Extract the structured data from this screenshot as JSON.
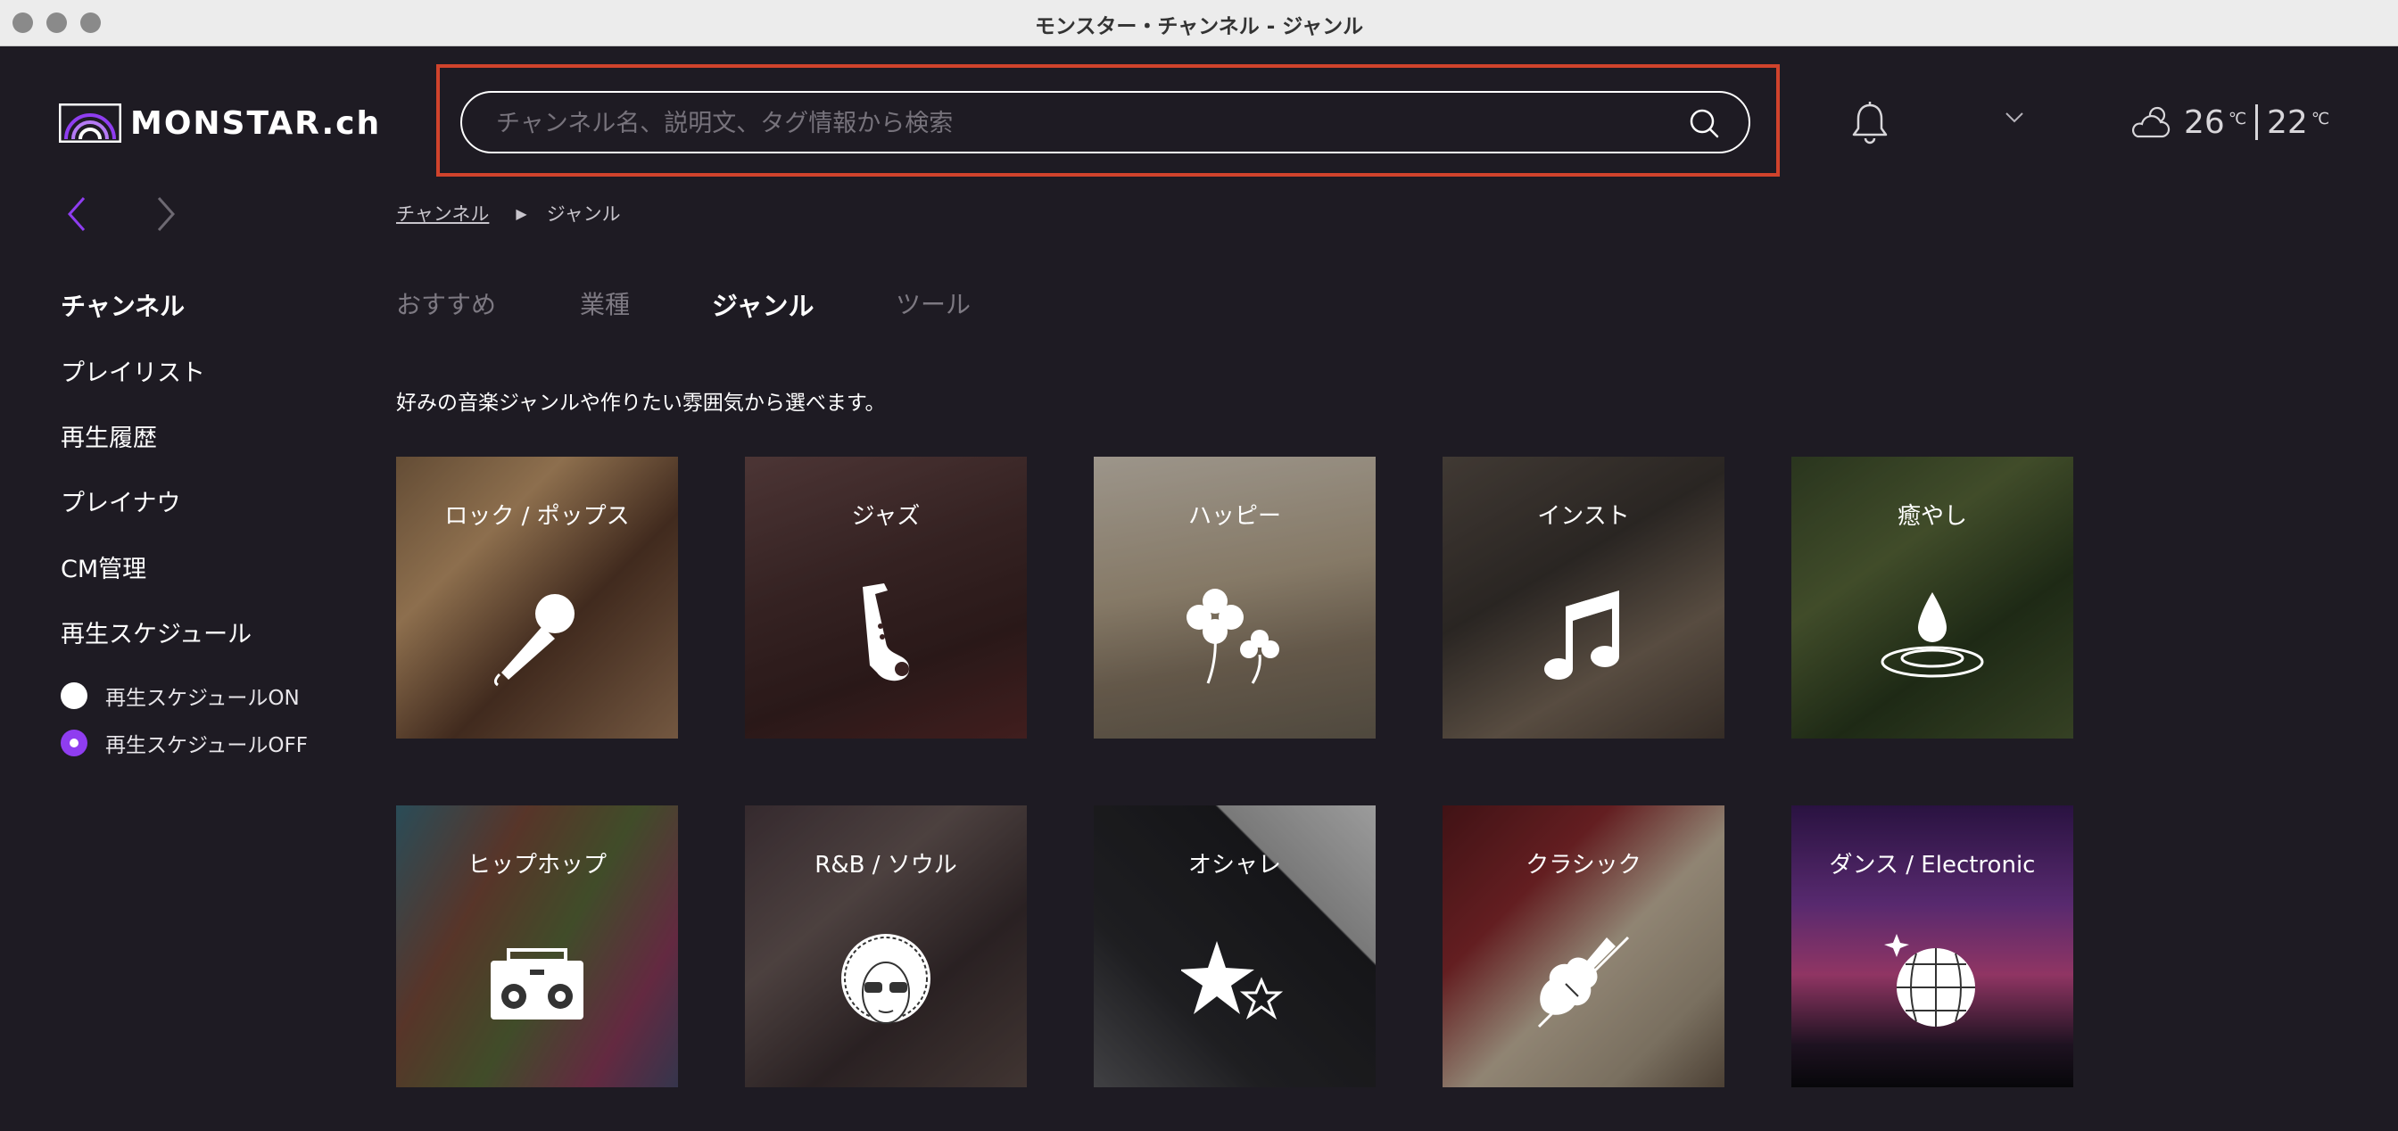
{
  "window": {
    "title": "モンスター・チャンネル - ジャンル"
  },
  "header": {
    "logo_text": "MONSTAR.ch",
    "search_placeholder": "チャンネル名、説明文、タグ情報から検索",
    "weather": {
      "high": "26",
      "high_unit": "℃",
      "low": "22",
      "low_unit": "℃",
      "icon": "cloud-sun-icon"
    }
  },
  "sidebar": {
    "items": [
      {
        "label": "チャンネル",
        "active": true
      },
      {
        "label": "プレイリスト",
        "active": false
      },
      {
        "label": "再生履歴",
        "active": false
      },
      {
        "label": "プレイナウ",
        "active": false
      },
      {
        "label": "CM管理",
        "active": false
      },
      {
        "label": "再生スケジュール",
        "active": false
      }
    ],
    "schedule_options": [
      {
        "label": "再生スケジュールON",
        "selected": false
      },
      {
        "label": "再生スケジュールOFF",
        "selected": true
      }
    ]
  },
  "breadcrumb": {
    "link": "チャンネル",
    "separator": "▶",
    "current": "ジャンル"
  },
  "tabs": [
    {
      "label": "おすすめ",
      "active": false
    },
    {
      "label": "業種",
      "active": false
    },
    {
      "label": "ジャンル",
      "active": true
    },
    {
      "label": "ツール",
      "active": false
    }
  ],
  "description": "好みの音楽ジャンルや作りたい雰囲気から選べます。",
  "genres": [
    {
      "label": "ロック / ポップス",
      "icon": "microphone-icon"
    },
    {
      "label": "ジャズ",
      "icon": "saxophone-icon"
    },
    {
      "label": "ハッピー",
      "icon": "clover-icon"
    },
    {
      "label": "インスト",
      "icon": "music-note-icon"
    },
    {
      "label": "癒やし",
      "icon": "water-drop-icon"
    },
    {
      "label": "ヒップホップ",
      "icon": "boombox-icon"
    },
    {
      "label": "R&B / ソウル",
      "icon": "afro-face-icon"
    },
    {
      "label": "オシャレ",
      "icon": "stars-icon"
    },
    {
      "label": "クラシック",
      "icon": "violin-icon"
    },
    {
      "label": "ダンス / Electronic",
      "icon": "disco-ball-icon"
    }
  ],
  "colors": {
    "background": "#1e1b23",
    "accent": "#8f3df0",
    "highlight_border": "#d0432c"
  }
}
